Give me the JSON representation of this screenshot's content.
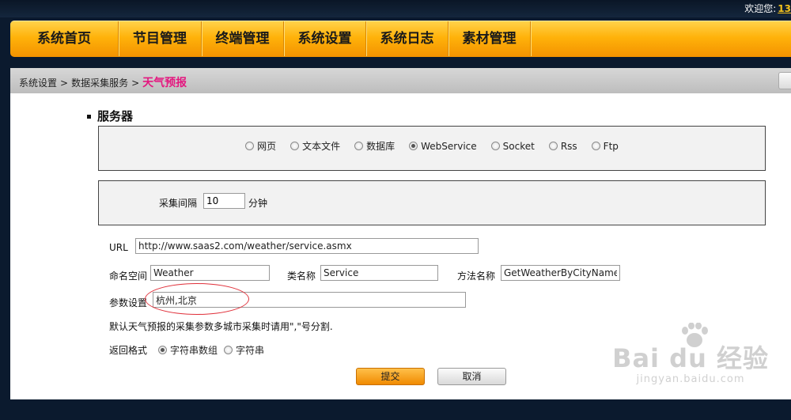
{
  "header": {
    "welcome_text": "欢迎您:",
    "user_fragment": "13"
  },
  "nav": {
    "items": [
      "系统首页",
      "节目管理",
      "终端管理",
      "系统设置",
      "系统日志",
      "素材管理"
    ]
  },
  "breadcrumb": {
    "items": [
      "系统设置",
      "数据采集服务"
    ],
    "separator": ">",
    "current": "天气预报"
  },
  "server_section": {
    "title": "服务器",
    "protocols": [
      {
        "label": "网页",
        "checked": false
      },
      {
        "label": "文本文件",
        "checked": false
      },
      {
        "label": "数据库",
        "checked": false
      },
      {
        "label": "WebService",
        "checked": true
      },
      {
        "label": "Socket",
        "checked": false
      },
      {
        "label": "Rss",
        "checked": false
      },
      {
        "label": "Ftp",
        "checked": false
      }
    ]
  },
  "interval": {
    "label": "采集间隔",
    "value": "10",
    "unit": "分钟"
  },
  "form": {
    "url_label": "URL",
    "url_value": "http://www.saas2.com/weather/service.asmx",
    "namespace_label": "命名空间",
    "namespace_value": "Weather",
    "class_label": "类名称",
    "class_value": "Service",
    "method_label": "方法名称",
    "method_value": "GetWeatherByCityNames",
    "params_label": "参数设置",
    "params_value": "杭州,北京",
    "hint": "默认天气预报的采集参数多城市采集时请用\",\"号分割.",
    "format_label": "返回格式",
    "format_options": [
      {
        "label": "字符串数组",
        "checked": true
      },
      {
        "label": "字符串",
        "checked": false
      }
    ]
  },
  "buttons": {
    "submit": "提交",
    "cancel": "取消"
  },
  "watermark": {
    "main": "Bai du 经验",
    "sub": "jingyan.baidu.com"
  },
  "colors": {
    "nav_orange": "#ffb20a",
    "breadcrumb_current": "#e4177f",
    "annotation_red": "#e0303a",
    "background_dark": "#0b1a2e"
  }
}
